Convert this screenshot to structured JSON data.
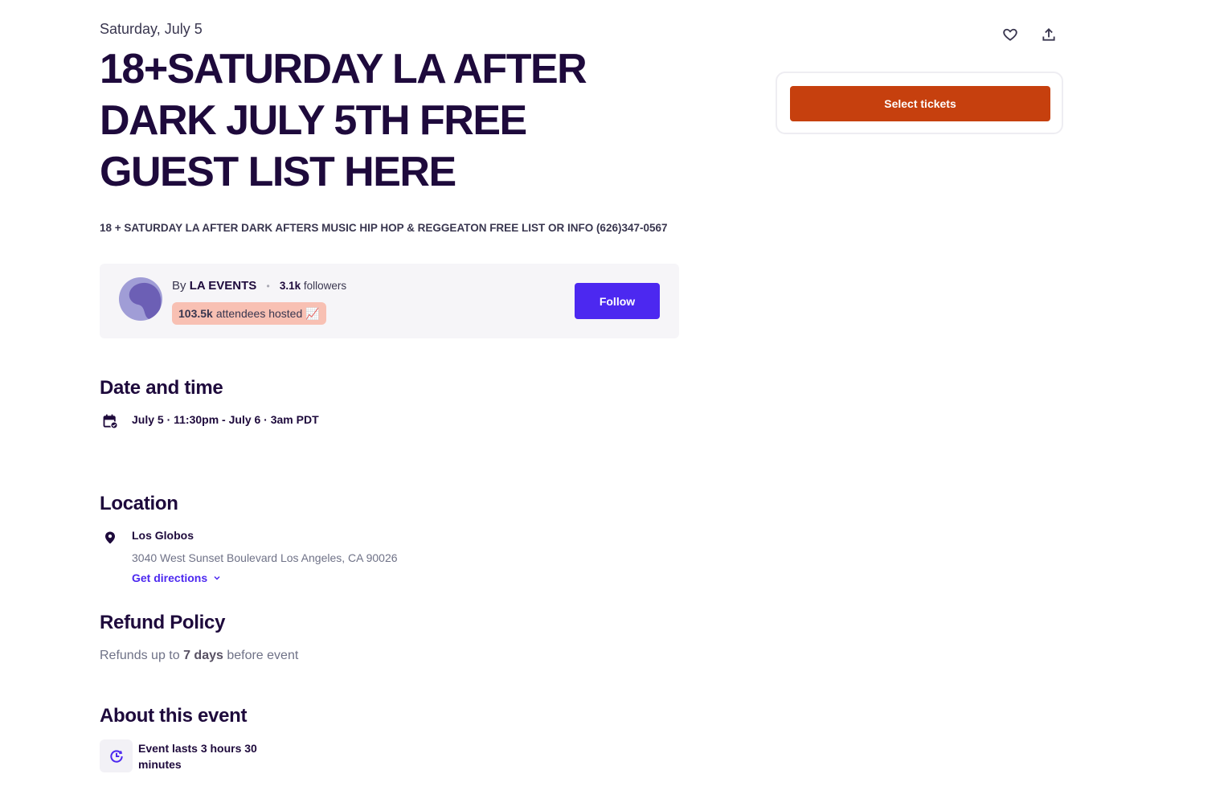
{
  "event": {
    "date_label": "Saturday, July 5",
    "title": "18+SATURDAY LA AFTER DARK JULY 5TH FREE GUEST LIST HERE",
    "summary": "18 + SATURDAY LA AFTER DARK AFTERS MUSIC HIP HOP & REGGEATON FREE LIST OR INFO (626)347-0567"
  },
  "organizer": {
    "by_prefix": "By",
    "name": "LA EVENTS",
    "separator": "•",
    "followers_count": "3.1k",
    "followers_label": "followers",
    "attendees_count": "103.5k",
    "attendees_label": "attendees hosted 📈",
    "follow_button": "Follow"
  },
  "date_time": {
    "heading": "Date and time",
    "value": "July 5 · 11:30pm - July 6 · 3am PDT"
  },
  "location": {
    "heading": "Location",
    "venue": "Los Globos",
    "address": "3040 West Sunset Boulevard Los Angeles, CA 90026",
    "directions_label": "Get directions"
  },
  "refund": {
    "heading": "Refund Policy",
    "prefix": "Refunds up to ",
    "days": "7 days",
    "suffix": " before event"
  },
  "about": {
    "heading": "About this event",
    "duration": "Event lasts 3 hours 30 minutes"
  },
  "tickets": {
    "select_button": "Select tickets"
  },
  "icons": {
    "like": "heart-icon",
    "share": "share-icon",
    "calendar": "calendar-icon",
    "location": "map-pin-icon",
    "chevron": "chevron-down-icon",
    "clock": "clock-icon"
  },
  "colors": {
    "primary_text": "#1e0a3c",
    "follow": "#4c28f0",
    "ticket_button": "#c6400e",
    "hosted_badge": "#f8c0b3"
  }
}
